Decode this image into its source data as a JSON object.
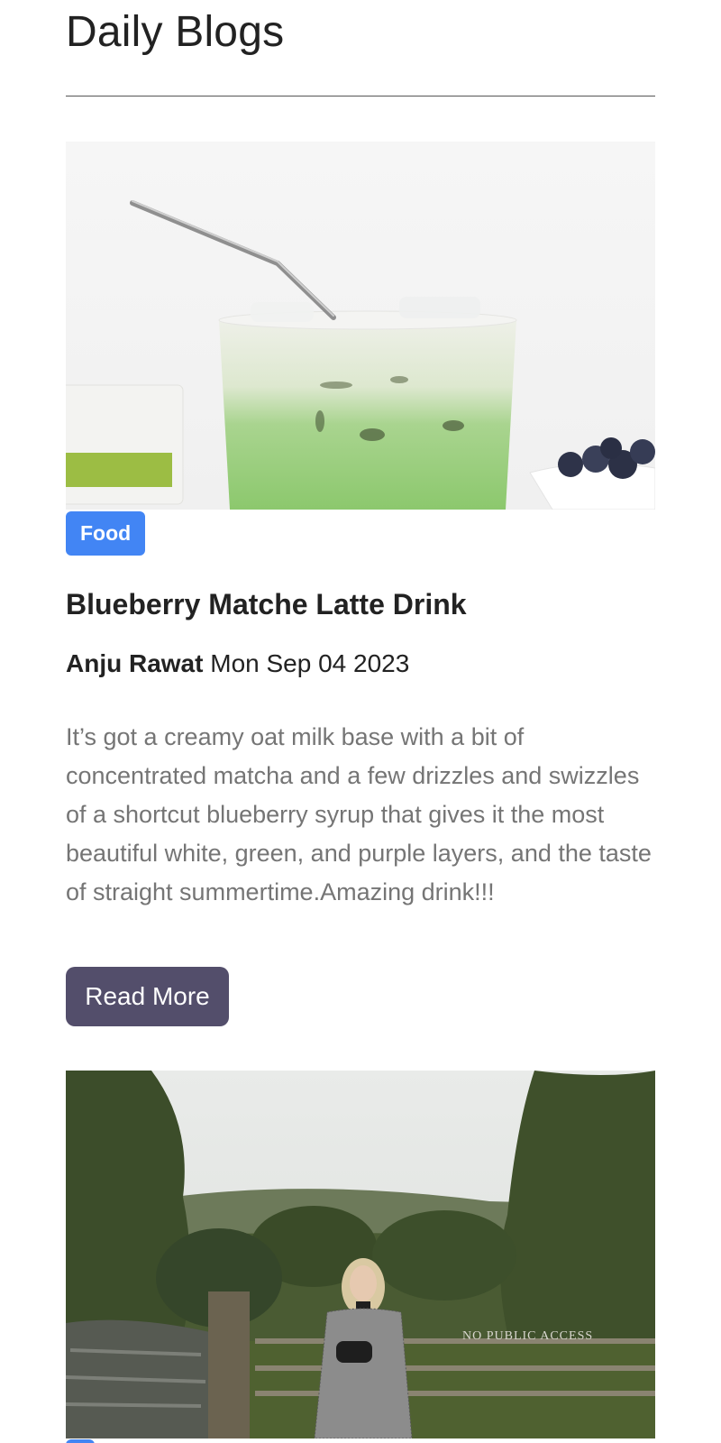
{
  "header": {
    "title": "Daily Blogs"
  },
  "posts": [
    {
      "category": "Food",
      "title": "Blueberry Matche Latte Drink",
      "author": "Anju Rawat",
      "date": "Mon Sep 04 2023",
      "excerpt": "It’s got a creamy oat milk base with a bit of concentrated matcha and a few drizzles and swizzles of a shortcut blueberry syrup that gives it the most beautiful white, green, and purple layers, and the taste of straight summertime.Amazing drink!!!",
      "button_label": "Read More"
    },
    {
      "image_sign_text": "NO PUBLIC ACCESS"
    }
  ],
  "colors": {
    "badge": "#4285f4",
    "button": "#534e6b",
    "excerpt_text": "#757575"
  }
}
